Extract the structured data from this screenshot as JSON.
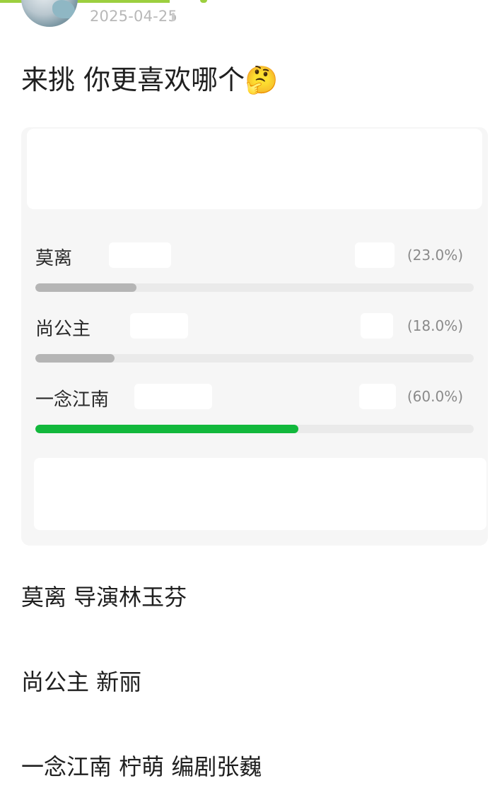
{
  "post": {
    "date": "2025-04-25",
    "title": "来挑 你更喜欢哪个",
    "title_emoji": "🤔"
  },
  "poll": {
    "options": [
      {
        "label": "莫离",
        "percent_text": "(23.0%)",
        "percent": 23.0,
        "winner": false
      },
      {
        "label": "尚公主",
        "percent_text": "(18.0%)",
        "percent": 18.0,
        "winner": false
      },
      {
        "label": "一念江南",
        "percent_text": "(60.0%)",
        "percent": 60.0,
        "winner": true
      }
    ],
    "colors": {
      "winner_bar": "#12b83c",
      "other_bar": "#b5b5b5",
      "track": "#eaeaea"
    }
  },
  "descriptions": [
    {
      "text": "莫离 导演林玉芬"
    },
    {
      "text": "尚公主 新丽"
    },
    {
      "text": "一念江南 柠萌 编剧张巍"
    }
  ],
  "icons": {
    "avatar": "user-avatar"
  }
}
